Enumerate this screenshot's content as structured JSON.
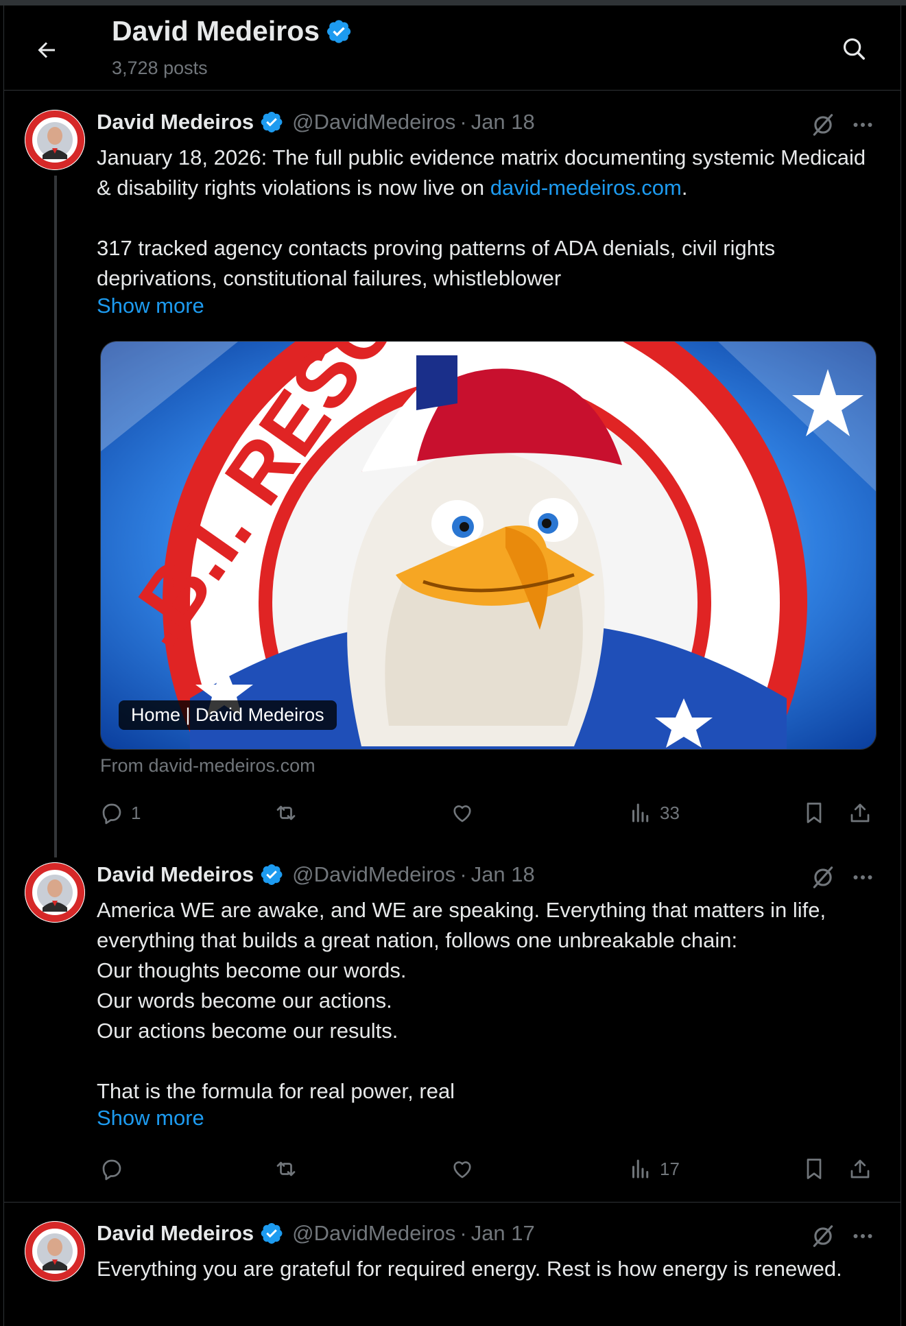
{
  "header": {
    "title": "David Medeiros",
    "post_count": "3,728 posts"
  },
  "posts": [
    {
      "name": "David Medeiros",
      "handle": "@DavidMedeiros",
      "separator": "·",
      "date": "Jan 18",
      "text_before_link": "January 18, 2026: The full public evidence matrix documenting systemic Medicaid & disability rights violations is now live on ",
      "link": "david-medeiros.com",
      "text_after_link": ".\n\n317 tracked agency contacts proving patterns of ADA denials, civil rights deprivations, constitutional failures, whistleblower",
      "show_more": "Show more",
      "card": {
        "label": "Home | David Medeiros",
        "from": "From david-medeiros.com",
        "image_text": ".B.I. RESOURCES",
        "image_description": "cartoon bald eagle in cap"
      },
      "stats": {
        "replies": "1",
        "reposts": "",
        "likes": "",
        "views": "33"
      }
    },
    {
      "name": "David Medeiros",
      "handle": "@DavidMedeiros",
      "separator": "·",
      "date": "Jan 18",
      "text": "America WE are awake, and WE are speaking. Everything that matters in life, everything that builds a great nation, follows one unbreakable chain:\nOur thoughts become our words.\nOur words become our actions.\nOur actions become our results.\n\nThat is the formula for real power, real",
      "show_more": "Show more",
      "stats": {
        "replies": "",
        "reposts": "",
        "likes": "",
        "views": "17"
      }
    },
    {
      "name": "David Medeiros",
      "handle": "@DavidMedeiros",
      "separator": "·",
      "date": "Jan 17",
      "text": "Everything you are grateful for required energy. Rest is how energy is renewed."
    }
  ],
  "colors": {
    "background": "#000000",
    "text": "#e7e9ea",
    "muted": "#71767b",
    "accent": "#1d9bf0",
    "border": "#2f3336"
  },
  "icons": [
    "back-arrow-icon",
    "search-icon",
    "verified-badge-icon",
    "grok-icon",
    "more-icon",
    "reply-icon",
    "repost-icon",
    "like-icon",
    "views-icon",
    "bookmark-icon",
    "share-icon"
  ]
}
